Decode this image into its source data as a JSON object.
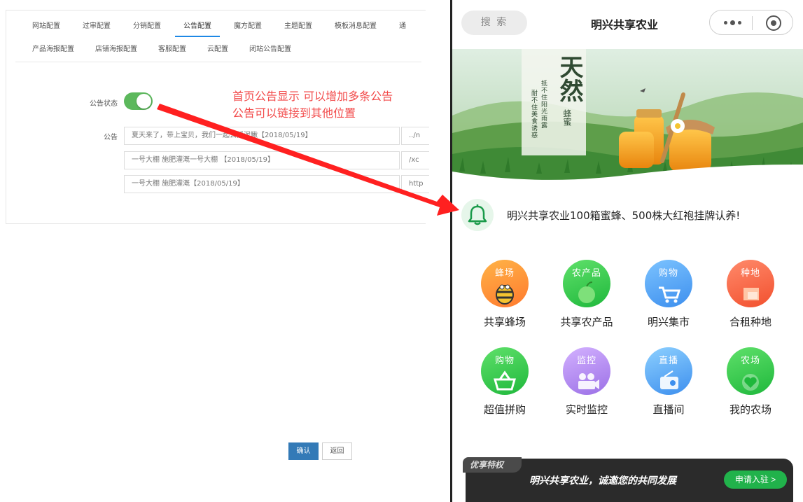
{
  "admin": {
    "tabs_row1": [
      "网站配置",
      "过审配置",
      "分销配置",
      "公告配置",
      "魔方配置",
      "主题配置",
      "模板消息配置",
      "通"
    ],
    "tabs_row2": [
      "产品海报配置",
      "店铺海报配置",
      "客服配置",
      "云配置",
      "闭站公告配置"
    ],
    "active_tab": "公告配置",
    "status_label": "公告状态",
    "notice_label": "公告",
    "notices": [
      {
        "text": "夏天来了，带上宝贝，我们一起去抓泥鳅【2018/05/19】",
        "link": "../n"
      },
      {
        "text": "一号大棚 施肥灌溉一号大棚 【2018/05/19】",
        "link": "/xc"
      },
      {
        "text": "一号大棚 施肥灌溉【2018/05/19】",
        "link": "http"
      }
    ],
    "annotation_line1": "首页公告显示 可以增加多条公告",
    "annotation_line2": "公告可以链接到其他位置",
    "confirm_label": "确认",
    "back_label": "返回",
    "toggle_on": true
  },
  "phone": {
    "search_label": "搜 索",
    "title": "明兴共享农业",
    "banner": {
      "main_char1": "天",
      "main_char2": "然",
      "sub": "蜂蜜",
      "poem1": "抵不住阳光雨露",
      "poem2": "耐不住美食诱惑"
    },
    "notice": "明兴共享农业100箱蜜蜂、500株大红袍挂牌认养!",
    "grid": [
      {
        "circle_text": "蜂场",
        "label": "共享蜂场",
        "icon": "bee-icon",
        "color_a": "#ffb347",
        "color_b": "#ff7a2e"
      },
      {
        "circle_text": "农产品",
        "label": "共享农产品",
        "icon": "apple-icon",
        "color_a": "#5fe06a",
        "color_b": "#1fb83c"
      },
      {
        "circle_text": "购物",
        "label": "明兴集市",
        "icon": "cart-icon",
        "color_a": "#7cc3ff",
        "color_b": "#3d8fee"
      },
      {
        "circle_text": "种地",
        "label": "合租种地",
        "icon": "flag-icon",
        "color_a": "#ff8a6b",
        "color_b": "#f2502e"
      },
      {
        "circle_text": "购物",
        "label": "超值拼购",
        "icon": "basket-icon",
        "color_a": "#5fe06a",
        "color_b": "#1fb83c"
      },
      {
        "circle_text": "监控",
        "label": "实时监控",
        "icon": "camera-icon",
        "color_a": "#d3b1ff",
        "color_b": "#9b70e6"
      },
      {
        "circle_text": "直播",
        "label": "直播间",
        "icon": "radio-icon",
        "color_a": "#8dd0ff",
        "color_b": "#3d8fee"
      },
      {
        "circle_text": "农场",
        "label": "我的农场",
        "icon": "heart-icon",
        "color_a": "#5fe06a",
        "color_b": "#1fb83c"
      }
    ],
    "promo_tag": "优享特权",
    "promo_text": "明兴共享农业，诚邀您的共同发展",
    "promo_button": "申请入驻 >"
  }
}
